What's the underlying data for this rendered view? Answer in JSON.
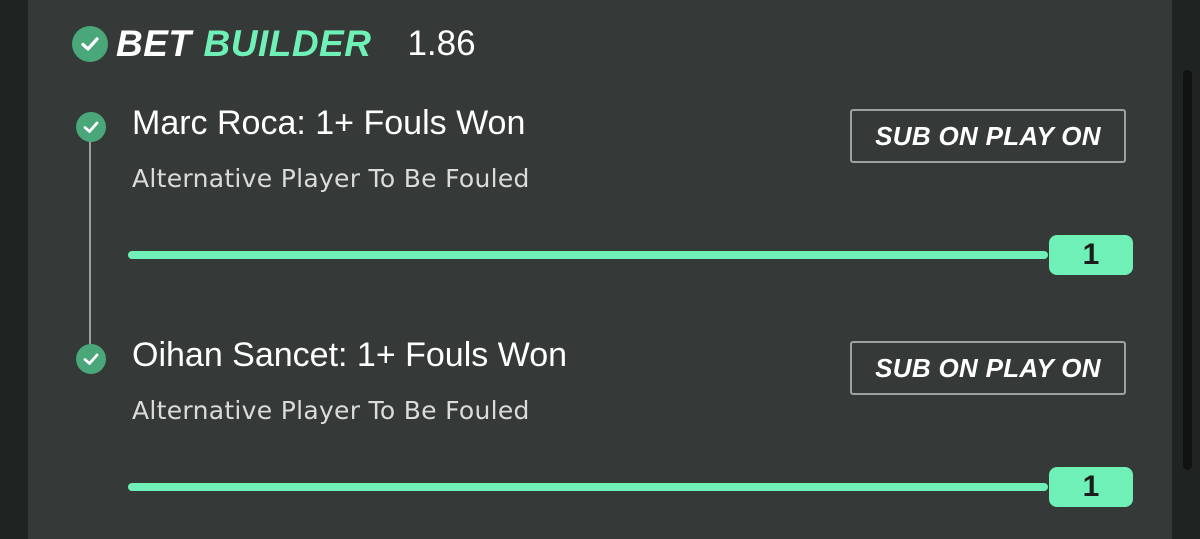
{
  "header": {
    "bet_label": "BET",
    "builder_label": "BUILDER",
    "odds": "1.86"
  },
  "legs": [
    {
      "title": "Marc Roca: 1+ Fouls Won",
      "subtitle": "Alternative Player To Be Fouled",
      "sub_button": "SUB ON PLAY ON",
      "slider_value": "1",
      "slider_level": 1.0
    },
    {
      "title": "Oihan Sancet: 1+ Fouls Won",
      "subtitle": "Alternative Player To Be Fouled",
      "sub_button": "SUB ON PLAY ON",
      "slider_value": "1",
      "slider_level": 1.0
    }
  ],
  "colors": {
    "accent": "#6ff0b7",
    "check": "#4aa77a",
    "panel": "#353937",
    "background": "#1f2321"
  },
  "icons": {
    "header": "check-circle-icon",
    "leg": "check-circle-icon"
  }
}
